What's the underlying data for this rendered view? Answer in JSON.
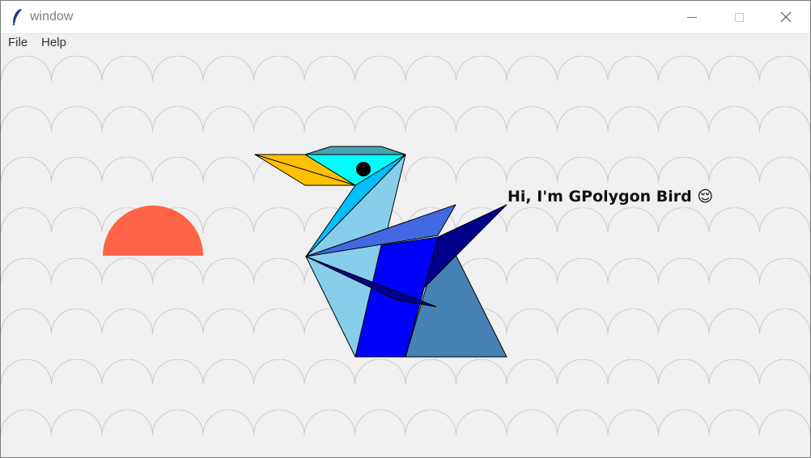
{
  "window": {
    "title": "window",
    "controls": {
      "minimize": "minimize-icon",
      "maximize": "maximize-icon",
      "close": "close-icon"
    }
  },
  "menu": {
    "items": [
      {
        "label": "File"
      },
      {
        "label": "Help"
      }
    ]
  },
  "canvas": {
    "background": "#f0f0f0",
    "pattern_stroke": "#c8c8c8",
    "sun_color": "#ff6347",
    "speech_text": "Hi, I'm GPolygon Bird 😌"
  },
  "bird": {
    "colors": {
      "beak": "#ffc000",
      "head_top": "#4aa3b0",
      "face": "#00ffff",
      "eye": "#000000",
      "neck_front": "#00bfff",
      "neck_back": "#87ceeb",
      "body_light": "#87ceeb",
      "wing_upper": "#4169e1",
      "wing_main": "#0000ff",
      "wing_dark": "#00008b",
      "tail": "#4682b4"
    }
  }
}
